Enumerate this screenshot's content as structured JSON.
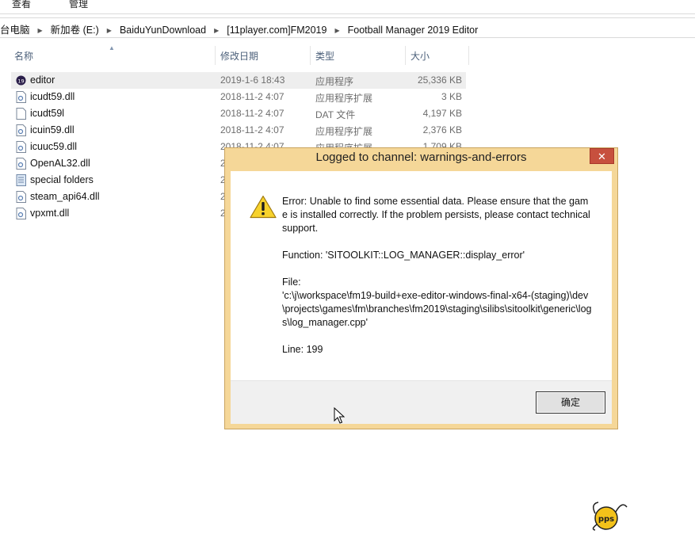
{
  "ribbon": {
    "tabs": [
      "查看",
      "管理"
    ]
  },
  "address": {
    "crumbs": [
      "台电脑",
      "新加卷 (E:)",
      "BaiduYunDownload",
      "[11player.com]FM2019",
      "Football Manager 2019 Editor"
    ]
  },
  "columns": {
    "name": "名称",
    "date": "修改日期",
    "type": "类型",
    "size": "大小"
  },
  "files": [
    {
      "name": "editor",
      "date": "2019-1-6 18:43",
      "type": "应用程序",
      "size": "25,336 KB",
      "icon": "fm-app-icon"
    },
    {
      "name": "icudt59.dll",
      "date": "2018-11-2 4:07",
      "type": "应用程序扩展",
      "size": "3 KB",
      "icon": "dll-icon"
    },
    {
      "name": "icudt59l",
      "date": "2018-11-2 4:07",
      "type": "DAT 文件",
      "size": "4,197 KB",
      "icon": "file-icon"
    },
    {
      "name": "icuin59.dll",
      "date": "2018-11-2 4:07",
      "type": "应用程序扩展",
      "size": "2,376 KB",
      "icon": "dll-icon"
    },
    {
      "name": "icuuc59.dll",
      "date": "2018-11-2 4:07",
      "type": "应用程序扩展",
      "size": "1,709 KB",
      "icon": "dll-icon"
    },
    {
      "name": "OpenAL32.dll",
      "date": "2",
      "type": "",
      "size": "",
      "icon": "dll-icon"
    },
    {
      "name": "special folders",
      "date": "2",
      "type": "",
      "size": "",
      "icon": "text-file-icon"
    },
    {
      "name": "steam_api64.dll",
      "date": "2",
      "type": "",
      "size": "",
      "icon": "dll-icon"
    },
    {
      "name": "vpxmt.dll",
      "date": "2",
      "type": "",
      "size": "",
      "icon": "dll-icon"
    }
  ],
  "dialog": {
    "title": "Logged to channel: warnings-and-errors",
    "close_label": "✕",
    "error_text": "Error: Unable to find some essential data. Please ensure that the game is installed correctly. If the problem persists, please contact technical support.",
    "function_text": "Function: 'SITOOLKIT::LOG_MANAGER::display_error'",
    "file_label": "File:",
    "file_path": "'c:\\j\\workspace\\fm19-build+exe-editor-windows-final-x64-(staging)\\dev\\projects\\games\\fm\\branches\\fm2019\\staging\\silibs\\sitoolkit\\generic\\logs\\log_manager.cpp'",
    "line_text": "Line: 199",
    "ok_label": "确定",
    "icon": "warning-icon"
  },
  "watermark": {
    "text": "pps"
  },
  "colors": {
    "dialog_frame": "#f5d798",
    "close_button": "#c7503e",
    "selected_row": "#eeeeee"
  }
}
